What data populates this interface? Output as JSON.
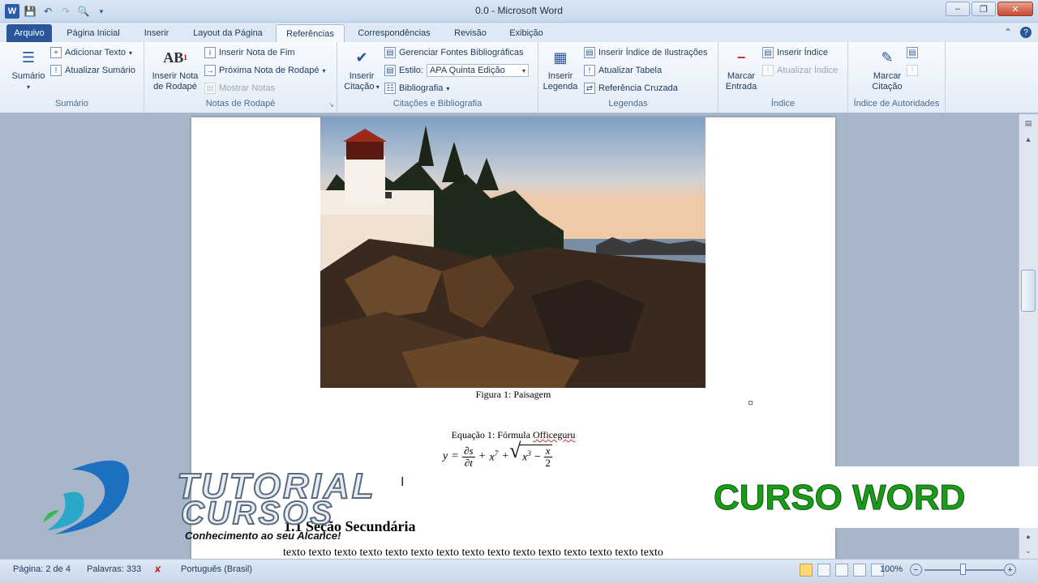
{
  "window": {
    "title": "0.0  -  Microsoft Word",
    "minimize": "–",
    "restore": "❐",
    "close": "✕"
  },
  "tabs": [
    {
      "label": "Arquivo"
    },
    {
      "label": "Página Inicial"
    },
    {
      "label": "Inserir"
    },
    {
      "label": "Layout da Página"
    },
    {
      "label": "Referências"
    },
    {
      "label": "Correspondências"
    },
    {
      "label": "Revisão"
    },
    {
      "label": "Exibição"
    }
  ],
  "ribbon": {
    "sumario": {
      "big": "Sumário",
      "add_text": "Adicionar Texto",
      "update": "Atualizar Sumário",
      "label": "Sumário"
    },
    "notas": {
      "insert_footnote_l1": "Inserir Nota",
      "insert_footnote_l2": "de Rodapé",
      "insert_endnote": "Inserir Nota de Fim",
      "next_footnote": "Próxima Nota de Rodapé",
      "show_notes": "Mostrar Notas",
      "label": "Notas de Rodapé"
    },
    "citacoes": {
      "insert_citation_l1": "Inserir",
      "insert_citation_l2": "Citação",
      "manage_sources": "Gerenciar Fontes Bibliográficas",
      "style_label": "Estilo:",
      "style_value": "APA Quinta Edição",
      "bibliography": "Bibliografia",
      "label": "Citações e Bibliografia"
    },
    "legendas": {
      "insert_caption_l1": "Inserir",
      "insert_caption_l2": "Legenda",
      "insert_table_figures": "Inserir Índice de Ilustrações",
      "update_table": "Atualizar Tabela",
      "cross_reference": "Referência Cruzada",
      "label": "Legendas"
    },
    "indice": {
      "mark_entry_l1": "Marcar",
      "mark_entry_l2": "Entrada",
      "insert_index": "Inserir Índice",
      "update_index": "Atualizar Índice",
      "label": "Índice"
    },
    "autoridades": {
      "mark_citation_l1": "Marcar",
      "mark_citation_l2": "Citação",
      "label": "Índice de Autoridades"
    }
  },
  "document": {
    "figure_caption": "Figura 1: Paisagem",
    "equation_caption_prefix": "Equação 1: Fórmula ",
    "equation_caption_word": "Officeguru",
    "heading": "1.1  Seção Secundária",
    "body_text": "texto texto texto texto texto texto texto texto texto texto texto texto texto texto texto"
  },
  "status": {
    "page": "Página: 2 de 4",
    "words": "Palavras: 333",
    "language": "Português (Brasil)",
    "zoom": "100%"
  },
  "watermark": {
    "brand_line1": "TUTORIAL",
    "brand_line2": "CURSOS",
    "slogan": "Conhecimento ao seu Alcance!",
    "course": "CURSO WORD"
  }
}
